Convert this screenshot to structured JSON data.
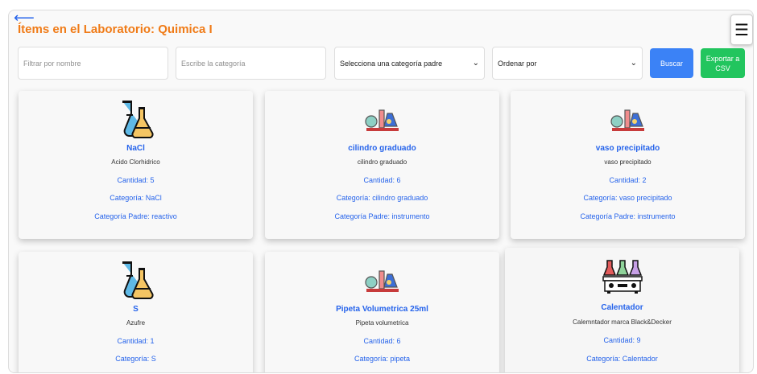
{
  "header": {
    "back_label": "⟵",
    "title": "Ítems en el Laboratorio: Quimica I",
    "menu_label": "☰"
  },
  "filters": {
    "name_placeholder": "Filtrar por nombre",
    "category_placeholder": "Escribe la categoría",
    "parent_select": "Selecciona una categoría padre",
    "order_select": "Ordenar por",
    "search_button": "Buscar",
    "export_button_line1": "Exportar a",
    "export_button_line2": "CSV"
  },
  "items": [
    {
      "name": "NaCl",
      "description": "Acido Clorhidrico",
      "quantity": "Cantidad: 5",
      "category": "Categoría: NaCl",
      "parent": "Categoría Padre: reactivo",
      "icon": "flasks-icon"
    },
    {
      "name": "cilindro graduado",
      "description": "cilindro graduado",
      "quantity": "Cantidad: 6",
      "category": "Categoría: cilindro graduado",
      "parent": "Categoría Padre: instrumento",
      "icon": "lab-equipment-icon"
    },
    {
      "name": "vaso precipitado",
      "description": "vaso precipitado",
      "quantity": "Cantidad: 2",
      "category": "Categoría: vaso precipitado",
      "parent": "Categoría Padre: instrumento",
      "icon": "lab-equipment-icon"
    },
    {
      "name": "S",
      "description": "Azufre",
      "quantity": "Cantidad: 1",
      "category": "Categoría: S",
      "parent": "",
      "icon": "flasks-icon"
    },
    {
      "name": "Pipeta Volumetrica 25ml",
      "description": "Pipeta volumetrica",
      "quantity": "Cantidad: 6",
      "category": "Categoría: pipeta",
      "parent": "",
      "icon": "lab-equipment-icon"
    },
    {
      "name": "Calentador",
      "description": "Calemntador marca Black&Decker",
      "quantity": "Cantidad: 9",
      "category": "Categoría: Calentador",
      "parent": "",
      "icon": "hot-plate-icon"
    }
  ],
  "colors": {
    "title": "#f07b17",
    "link": "#2563eb",
    "search": "#3b82f6",
    "export": "#22c55e"
  }
}
